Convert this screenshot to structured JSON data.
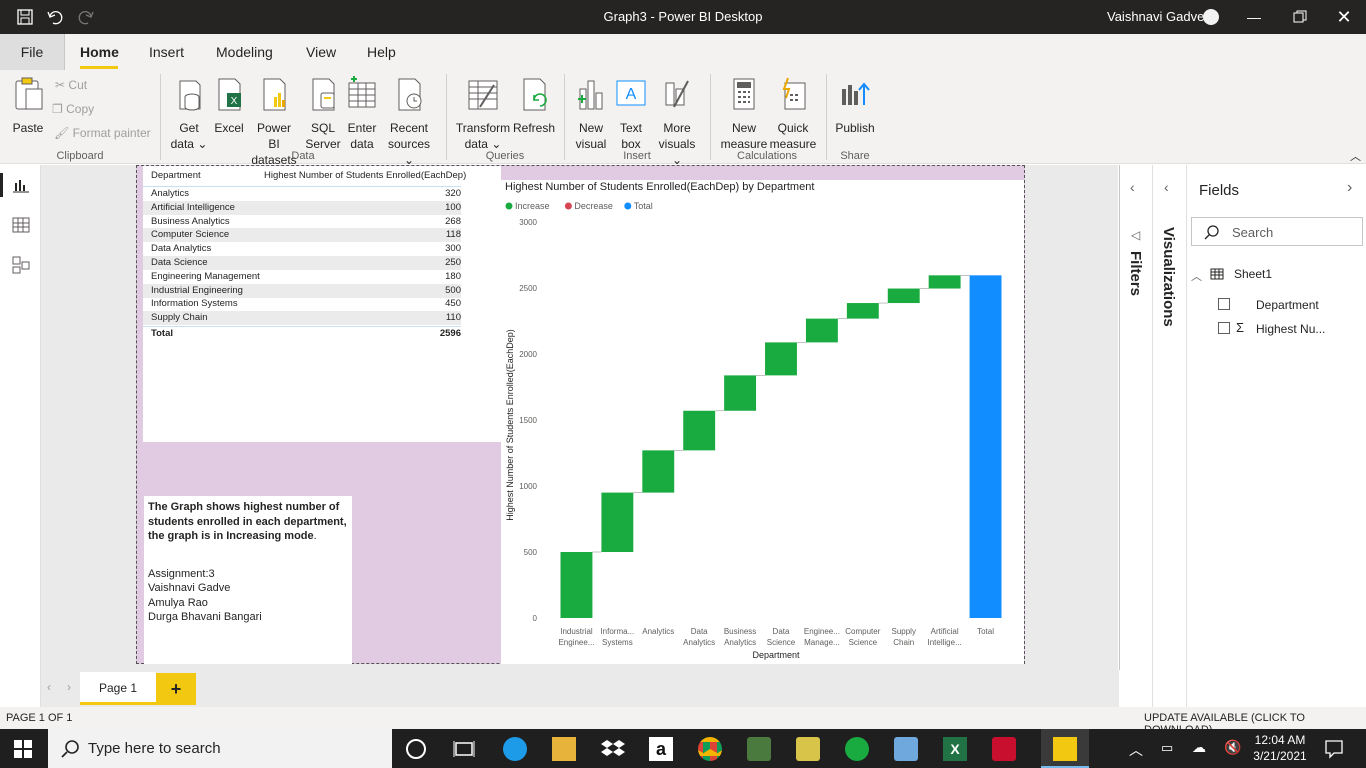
{
  "titlebar": {
    "title": "Graph3 - Power BI Desktop",
    "user": "Vaishnavi Gadve",
    "icons": [
      "save-icon",
      "undo-icon",
      "redo-icon"
    ],
    "window_controls": [
      "minimize",
      "restore",
      "close"
    ]
  },
  "menu": {
    "file": "File",
    "tabs": [
      "Home",
      "Insert",
      "Modeling",
      "View",
      "Help"
    ],
    "active": "Home"
  },
  "ribbon": {
    "clipboard": {
      "paste": "Paste",
      "cut": "Cut",
      "copy": "Copy",
      "format_painter": "Format painter",
      "label": "Clipboard"
    },
    "data": {
      "get_data": [
        "Get",
        "data"
      ],
      "excel": "Excel",
      "pbi_datasets": [
        "Power BI",
        "datasets"
      ],
      "sql": [
        "SQL",
        "Server"
      ],
      "enter_data": [
        "Enter",
        "data"
      ],
      "recent": [
        "Recent",
        "sources"
      ],
      "label": "Data"
    },
    "queries": {
      "transform": [
        "Transform",
        "data"
      ],
      "refresh": "Refresh",
      "label": "Queries"
    },
    "insert": {
      "new_visual": [
        "New",
        "visual"
      ],
      "text_box": [
        "Text",
        "box"
      ],
      "more": [
        "More",
        "visuals"
      ],
      "label": "Insert"
    },
    "calculations": {
      "new_measure": [
        "New",
        "measure"
      ],
      "quick_measure": [
        "Quick",
        "measure"
      ],
      "label": "Calculations"
    },
    "share": {
      "publish": "Publish",
      "label": "Share"
    }
  },
  "table": {
    "col1": "Department",
    "col2": "Highest Number of Students Enrolled(EachDep)",
    "rows": [
      {
        "dept": "Analytics",
        "val": "320"
      },
      {
        "dept": "Artificial Intelligence",
        "val": "100"
      },
      {
        "dept": "Business Analytics",
        "val": "268"
      },
      {
        "dept": "Computer Science",
        "val": "118"
      },
      {
        "dept": "Data Analytics",
        "val": "300"
      },
      {
        "dept": "Data Science",
        "val": "250"
      },
      {
        "dept": "Engineering Management",
        "val": "180"
      },
      {
        "dept": "Industrial Engineering",
        "val": "500"
      },
      {
        "dept": "Information Systems",
        "val": "450"
      },
      {
        "dept": "Supply Chain",
        "val": "110"
      }
    ],
    "total_label": "Total",
    "total_value": "2596"
  },
  "textbox": {
    "bold_line1": "The Graph shows highest number of",
    "bold_line2": "students enrolled in each department,",
    "bold_line3": "the graph is in Increasing mode",
    "line3_end": ".",
    "assignment": "Assignment:3",
    "names": [
      "Vaishnavi Gadve",
      "Amulya Rao",
      "Durga Bhavani Bangari"
    ]
  },
  "chart_data": {
    "type": "waterfall",
    "title": "Highest Number of Students Enrolled(EachDep) by Department",
    "legend": [
      "Increase",
      "Decrease",
      "Total"
    ],
    "legend_colors": [
      "#1aab40",
      "#d64554",
      "#118dff"
    ],
    "xlabel": "Department",
    "ylabel": "Highest Number of Students Enrolled(EachDep)",
    "ylim": [
      0,
      3000
    ],
    "yticks": [
      0,
      500,
      1000,
      1500,
      2000,
      2500,
      3000
    ],
    "categories": [
      [
        "Industrial",
        "Enginee..."
      ],
      [
        "Informa...",
        "Systems"
      ],
      [
        "Analytics"
      ],
      [
        "Data",
        "Analytics"
      ],
      [
        "Business",
        "Analytics"
      ],
      [
        "Data",
        "Science"
      ],
      [
        "Enginee...",
        "Manage..."
      ],
      [
        "Computer",
        "Science"
      ],
      [
        "Supply",
        "Chain"
      ],
      [
        "Artificial",
        "Intellige..."
      ],
      [
        "Total"
      ]
    ],
    "values": [
      500,
      450,
      320,
      300,
      268,
      250,
      180,
      118,
      110,
      100,
      2596
    ],
    "total_index": 10
  },
  "panes": {
    "filters": "Filters",
    "visualizations": "Visualizations",
    "fields": "Fields",
    "search_placeholder": "Search",
    "table_name": "Sheet1",
    "field1": "Department",
    "field2": "Highest Nu..."
  },
  "pages": {
    "tab": "Page 1",
    "add": "+"
  },
  "status": {
    "page": "PAGE 1 OF 1",
    "update": "UPDATE AVAILABLE (CLICK TO DOWNLOAD)"
  },
  "taskbar": {
    "search": "Type here to search",
    "time": "12:04 AM",
    "date": "3/21/2021"
  }
}
